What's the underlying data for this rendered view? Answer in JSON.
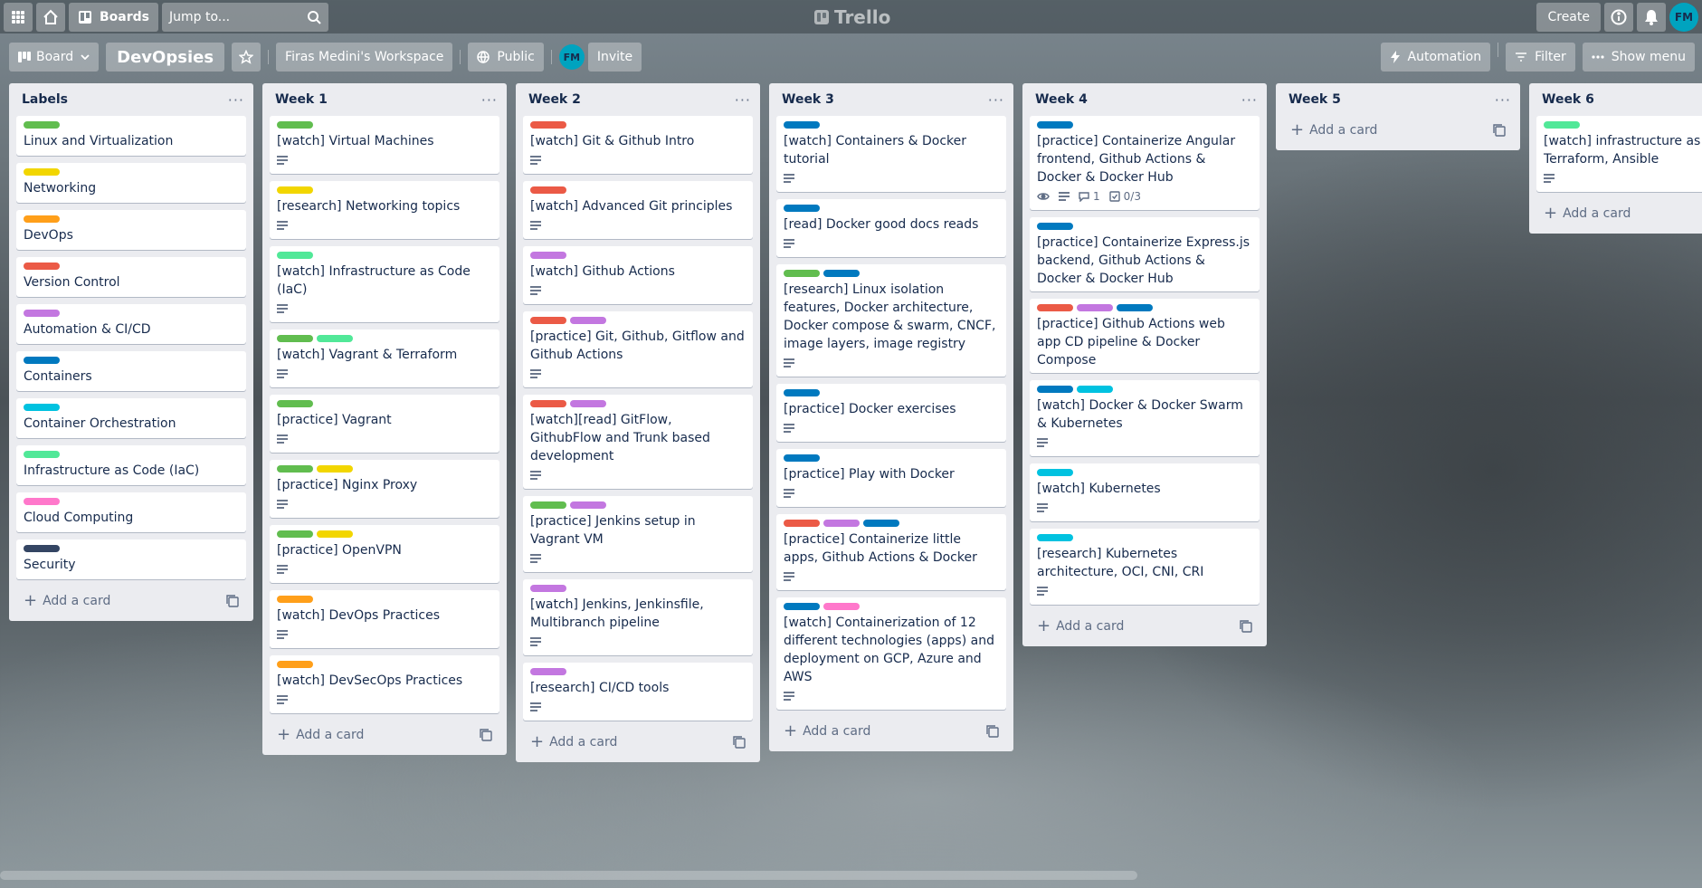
{
  "colors": {
    "green": "#61bd4f",
    "yellow": "#f2d600",
    "orange": "#ff9f1a",
    "red": "#eb5a46",
    "purple": "#c377e0",
    "blue": "#0079bf",
    "sky": "#00c2e0",
    "lime": "#51e898",
    "pink": "#ff78cb",
    "black": "#344563"
  },
  "header": {
    "boards_label": "Boards",
    "search_placeholder": "Jump to...",
    "logo": "Trello",
    "create_label": "Create",
    "avatar_initials": "FM"
  },
  "boardbar": {
    "view_label": "Board",
    "title": "DevOpsies",
    "workspace": "Firas Medini's Workspace",
    "visibility": "Public",
    "member_initials": "FM",
    "invite_label": "Invite",
    "automation_label": "Automation",
    "filter_label": "Filter",
    "show_menu_label": "Show menu"
  },
  "add_card_label": "Add a card",
  "lists": [
    {
      "title": "Labels",
      "cards": [
        {
          "title": "Linux and Virtualization",
          "labels": [
            "green"
          ],
          "desc": false
        },
        {
          "title": "Networking",
          "labels": [
            "yellow"
          ],
          "desc": false
        },
        {
          "title": "DevOps",
          "labels": [
            "orange"
          ],
          "desc": false
        },
        {
          "title": "Version Control",
          "labels": [
            "red"
          ],
          "desc": false
        },
        {
          "title": "Automation & CI/CD",
          "labels": [
            "purple"
          ],
          "desc": false
        },
        {
          "title": "Containers",
          "labels": [
            "blue"
          ],
          "desc": false
        },
        {
          "title": "Container Orchestration",
          "labels": [
            "sky"
          ],
          "desc": false
        },
        {
          "title": "Infrastructure as Code (IaC)",
          "labels": [
            "lime"
          ],
          "desc": false
        },
        {
          "title": "Cloud Computing",
          "labels": [
            "pink"
          ],
          "desc": false
        },
        {
          "title": "Security",
          "labels": [
            "black"
          ],
          "desc": false
        }
      ]
    },
    {
      "title": "Week 1",
      "cards": [
        {
          "title": "[watch] Virtual Machines",
          "labels": [
            "green"
          ],
          "desc": true
        },
        {
          "title": "[research] Networking topics",
          "labels": [
            "yellow"
          ],
          "desc": true
        },
        {
          "title": "[watch] Infrastructure as Code (IaC)",
          "labels": [
            "lime"
          ],
          "desc": true
        },
        {
          "title": "[watch] Vagrant & Terraform",
          "labels": [
            "green",
            "lime"
          ],
          "desc": true
        },
        {
          "title": "[practice] Vagrant",
          "labels": [
            "green"
          ],
          "desc": true
        },
        {
          "title": "[practice] Nginx Proxy",
          "labels": [
            "green",
            "yellow"
          ],
          "desc": true
        },
        {
          "title": "[practice] OpenVPN",
          "labels": [
            "green",
            "yellow"
          ],
          "desc": true
        },
        {
          "title": "[watch] DevOps Practices",
          "labels": [
            "orange"
          ],
          "desc": true
        },
        {
          "title": "[watch] DevSecOps Practices",
          "labels": [
            "orange"
          ],
          "desc": true
        }
      ]
    },
    {
      "title": "Week 2",
      "cards": [
        {
          "title": "[watch] Git & Github Intro",
          "labels": [
            "red"
          ],
          "desc": true
        },
        {
          "title": "[watch] Advanced Git principles",
          "labels": [
            "red"
          ],
          "desc": true
        },
        {
          "title": "[watch] Github Actions",
          "labels": [
            "purple"
          ],
          "desc": true
        },
        {
          "title": "[practice] Git, Github, Gitflow and Github Actions",
          "labels": [
            "red",
            "purple"
          ],
          "desc": true
        },
        {
          "title": "[watch][read] GitFlow, GithubFlow and Trunk based development",
          "labels": [
            "red",
            "purple"
          ],
          "desc": true
        },
        {
          "title": "[practice] Jenkins setup in Vagrant VM",
          "labels": [
            "green",
            "purple"
          ],
          "desc": true
        },
        {
          "title": "[watch] Jenkins, Jenkinsfile, Multibranch pipeline",
          "labels": [
            "purple"
          ],
          "desc": true
        },
        {
          "title": "[research] CI/CD tools",
          "labels": [
            "purple"
          ],
          "desc": true
        }
      ]
    },
    {
      "title": "Week 3",
      "cards": [
        {
          "title": "[watch] Containers & Docker tutorial",
          "labels": [
            "blue"
          ],
          "desc": true
        },
        {
          "title": "[read] Docker good docs reads",
          "labels": [
            "blue"
          ],
          "desc": true
        },
        {
          "title": "[research] Linux isolation features, Docker architecture, Docker compose & swarm, CNCF, image layers, image registry",
          "labels": [
            "green",
            "blue"
          ],
          "desc": true
        },
        {
          "title": "[practice] Docker exercises",
          "labels": [
            "blue"
          ],
          "desc": true
        },
        {
          "title": "[practice] Play with Docker",
          "labels": [
            "blue"
          ],
          "desc": true
        },
        {
          "title": "[practice] Containerize little apps, Github Actions & Docker",
          "labels": [
            "red",
            "purple",
            "blue"
          ],
          "desc": true
        },
        {
          "title": "[watch] Containerization of 12 different technologies (apps) and deployment on GCP, Azure and AWS",
          "labels": [
            "blue",
            "pink"
          ],
          "desc": true
        }
      ]
    },
    {
      "title": "Week 4",
      "cards": [
        {
          "title": "[practice] Containerize Angular frontend, Github Actions & Docker & Docker Hub",
          "labels": [
            "blue"
          ],
          "desc": true,
          "watch": true,
          "comments": "1",
          "checklist": "0/3"
        },
        {
          "title": "[practice] Containerize Express.js backend, Github Actions & Docker & Docker Hub",
          "labels": [
            "blue"
          ],
          "desc": false
        },
        {
          "title": "[practice] Github Actions web app CD pipeline & Docker Compose",
          "labels": [
            "red",
            "purple",
            "blue"
          ],
          "desc": false
        },
        {
          "title": "[watch] Docker & Docker Swarm & Kubernetes",
          "labels": [
            "blue",
            "sky"
          ],
          "desc": true
        },
        {
          "title": "[watch] Kubernetes",
          "labels": [
            "sky"
          ],
          "desc": true
        },
        {
          "title": "[research] Kubernetes architecture, OCI, CNI, CRI",
          "labels": [
            "sky"
          ],
          "desc": true
        }
      ]
    },
    {
      "title": "Week 5",
      "cards": []
    },
    {
      "title": "Week 6",
      "cards": [
        {
          "title": "[watch] infrastructure as code Terraform, Ansible",
          "labels": [
            "lime"
          ],
          "desc": true
        }
      ]
    }
  ]
}
